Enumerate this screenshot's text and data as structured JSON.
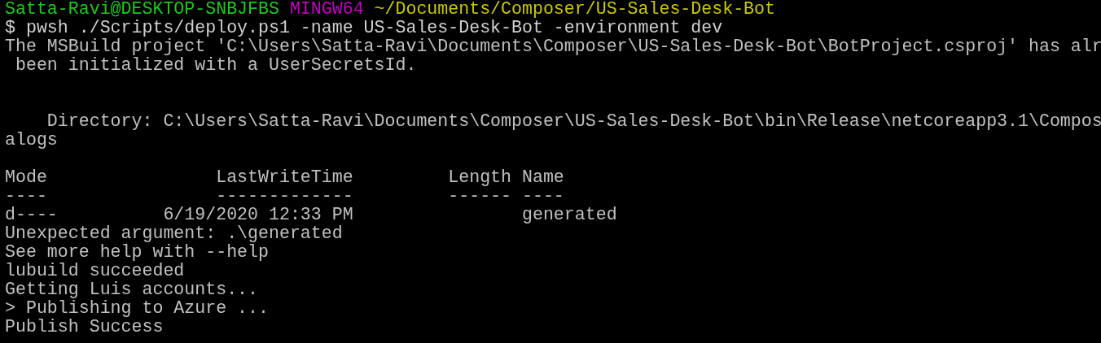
{
  "prompt": {
    "user_host": "Satta-Ravi@DESKTOP-SNBJFBS",
    "system": "MINGW64",
    "path": "~/Documents/Composer/US-Sales-Desk-Bot"
  },
  "lines": [
    {
      "kind": "command",
      "text": "$ pwsh ./Scripts/deploy.ps1 -name US-Sales-Desk-Bot -environment dev"
    },
    {
      "kind": "output",
      "text": "The MSBuild project 'C:\\Users\\Satta-Ravi\\Documents\\Composer\\US-Sales-Desk-Bot\\BotProject.csproj' has alr"
    },
    {
      "kind": "output",
      "text": " been initialized with a UserSecretsId."
    },
    {
      "kind": "blank"
    },
    {
      "kind": "blank"
    },
    {
      "kind": "output",
      "text": "    Directory: C:\\Users\\Satta-Ravi\\Documents\\Composer\\US-Sales-Desk-Bot\\bin\\Release\\netcoreapp3.1\\Compos"
    },
    {
      "kind": "output",
      "text": "alogs"
    },
    {
      "kind": "blank"
    },
    {
      "kind": "output",
      "text": "Mode                LastWriteTime         Length Name"
    },
    {
      "kind": "output",
      "text": "----                -------------         ------ ----"
    },
    {
      "kind": "output",
      "text": "d----          6/19/2020 12:33 PM                generated"
    },
    {
      "kind": "output",
      "text": "Unexpected argument: .\\generated"
    },
    {
      "kind": "output",
      "text": "See more help with --help"
    },
    {
      "kind": "output",
      "text": "lubuild succeeded"
    },
    {
      "kind": "output",
      "text": "Getting Luis accounts..."
    },
    {
      "kind": "output",
      "text": "> Publishing to Azure ..."
    },
    {
      "kind": "output",
      "text": "Publish Success"
    }
  ]
}
